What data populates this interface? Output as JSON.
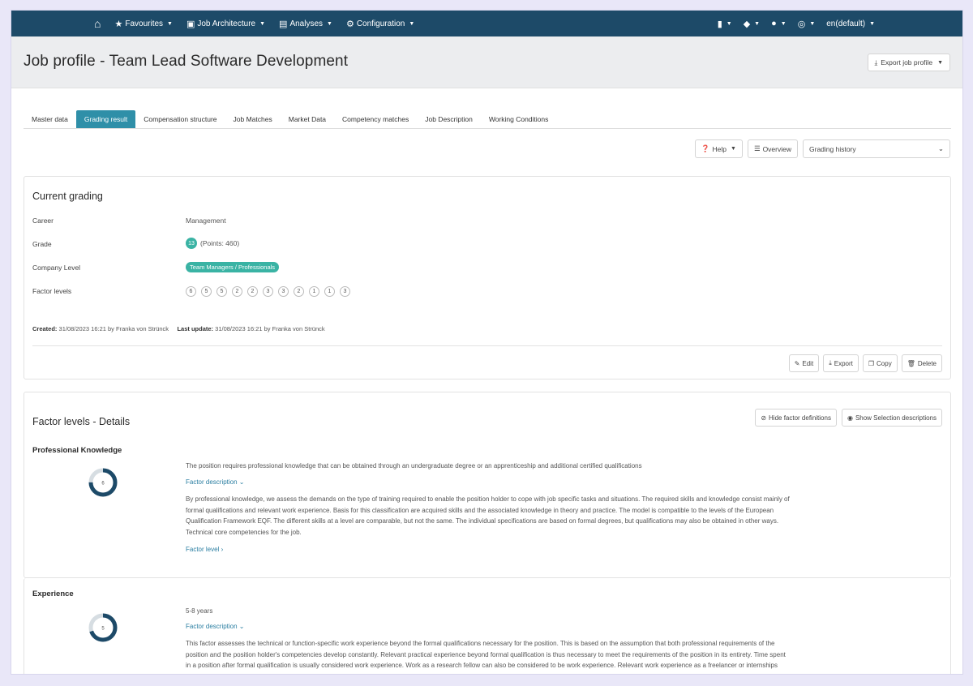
{
  "nav": {
    "items": [
      {
        "label": "Favourites",
        "icon": "star-icon",
        "glyph": "★"
      },
      {
        "label": "Job Architecture",
        "icon": "briefcase-icon",
        "glyph": "▣"
      },
      {
        "label": "Analyses",
        "icon": "table-icon",
        "glyph": "▤"
      },
      {
        "label": "Configuration",
        "icon": "gear-icon",
        "glyph": "⚙"
      }
    ],
    "language": "en(default)"
  },
  "header": {
    "title": "Job profile - Team Lead Software Development",
    "export_label": "Export job profile"
  },
  "tabs": [
    {
      "label": "Master data",
      "active": false
    },
    {
      "label": "Grading result",
      "active": true
    },
    {
      "label": "Compensation structure",
      "active": false
    },
    {
      "label": "Job Matches",
      "active": false
    },
    {
      "label": "Market Data",
      "active": false
    },
    {
      "label": "Competency matches",
      "active": false
    },
    {
      "label": "Job Description",
      "active": false
    },
    {
      "label": "Working Conditions",
      "active": false
    }
  ],
  "toolbar": {
    "help_label": "Help",
    "overview_label": "Overview",
    "history_select": "Grading history"
  },
  "current_grading": {
    "title": "Current grading",
    "career_label": "Career",
    "career_value": "Management",
    "grade_label": "Grade",
    "grade_badge": "13",
    "grade_points": "(Points: 460)",
    "company_level_label": "Company Level",
    "company_level_value": "Team Managers / Professionals",
    "factor_levels_label": "Factor levels",
    "factor_levels": [
      "6",
      "5",
      "5",
      "2",
      "2",
      "3",
      "3",
      "2",
      "1",
      "1",
      "3"
    ],
    "created_label": "Created:",
    "created_value": "31/08/2023 16:21 by Franka von Strünck",
    "updated_label": "Last update:",
    "updated_value": "31/08/2023 16:21 by Franka von Strünck",
    "edit_label": "Edit",
    "export_label": "Export",
    "copy_label": "Copy",
    "delete_label": "Delete"
  },
  "factor_details": {
    "title": "Factor levels - Details",
    "hide_defs_label": "Hide factor definitions",
    "show_desc_label": "Show Selection descriptions",
    "factors": [
      {
        "name": "Professional Knowledge",
        "level": "6",
        "fill": 0.75,
        "summary": "The position requires professional knowledge that can be obtained through an undergraduate degree or an apprenticeship and additional certified qualifications",
        "desc_link": "Factor description ⌄",
        "description": "By professional knowledge, we assess the demands on the type of training required to enable the position holder to cope with job specific tasks and situations. The required skills and knowledge consist mainly of formal qualifications and relevant work experience. Basis for this classification are acquired skills and the associated knowledge in theory and practice. The model is compatible to the levels of the European Qualification Framework EQF. The different skills at a level are comparable, but not the same. The individual specifications are based on formal degrees, but qualifications may also be obtained in other ways. Technical core competencies for the job.",
        "level_link": "Factor level ›"
      },
      {
        "name": "Experience",
        "level": "5",
        "fill": 0.7,
        "summary": "5-8 years",
        "desc_link": "Factor description ⌄",
        "description": "This factor assesses the technical or function-specific work experience beyond the formal qualifications necessary for the position. This is based on the assumption that both professional requirements of the position and the position holder's competencies develop constantly. Relevant practical experience beyond formal qualification is thus necessary to meet the requirements of the position in its entirety. Time spent in a position after formal qualification is usually considered work experience. Work as a research fellow can also be considered to be work experience. Relevant work experience as a freelancer or internships can be regarded as adequate work experience, too. Business and organisation-specific knowledge is not assessed in this factor, it is"
      }
    ]
  },
  "colors": {
    "navbar": "#1d4a68",
    "accent": "#2f8fa8",
    "badge": "#3ab3a4",
    "donut": "#1d4a68"
  }
}
